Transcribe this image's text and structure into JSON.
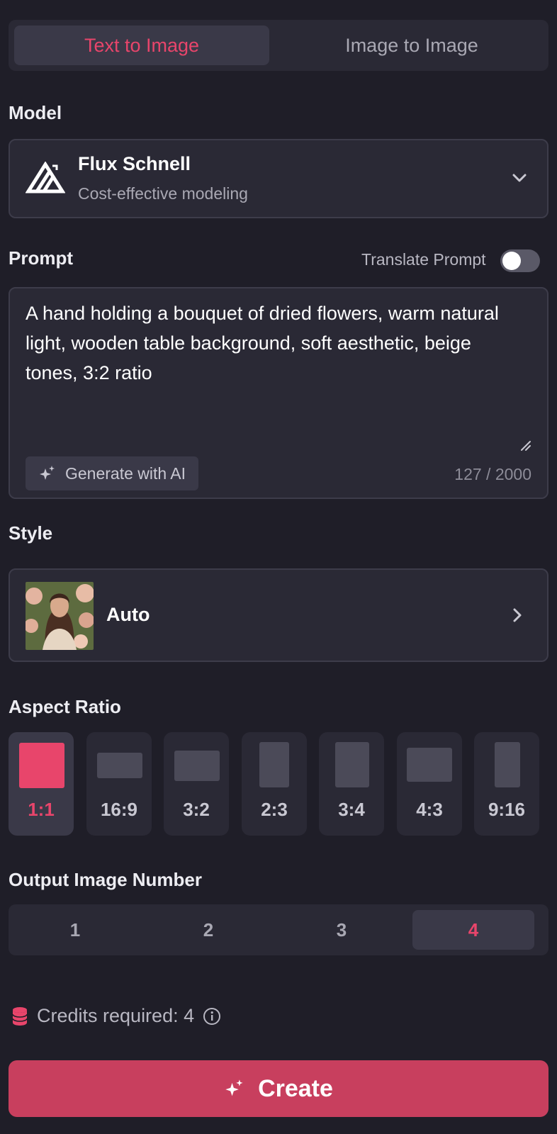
{
  "tabs": [
    {
      "label": "Text to Image",
      "active": true
    },
    {
      "label": "Image to Image",
      "active": false
    }
  ],
  "model": {
    "section_label": "Model",
    "name": "Flux Schnell",
    "description": "Cost-effective modeling",
    "icon": "chevron-down-icon"
  },
  "prompt": {
    "section_label": "Prompt",
    "translate_label": "Translate Prompt",
    "translate_enabled": false,
    "text": "A hand holding a bouquet of dried flowers, warm natural light, wooden table background, soft aesthetic, beige tones, 3:2 ratio",
    "generate_label": "Generate with AI",
    "char_count": "127 / 2000"
  },
  "style": {
    "section_label": "Style",
    "value": "Auto"
  },
  "aspect_ratio": {
    "section_label": "Aspect Ratio",
    "options": [
      {
        "label": "1:1",
        "active": true
      },
      {
        "label": "16:9",
        "active": false
      },
      {
        "label": "3:2",
        "active": false
      },
      {
        "label": "2:3",
        "active": false
      },
      {
        "label": "3:4",
        "active": false
      },
      {
        "label": "4:3",
        "active": false
      },
      {
        "label": "9:16",
        "active": false
      }
    ]
  },
  "output_number": {
    "section_label": "Output Image Number",
    "options": [
      "1",
      "2",
      "3",
      "4"
    ],
    "selected": "4"
  },
  "credits": {
    "label": "Credits required: 4"
  },
  "create": {
    "label": "Create"
  },
  "colors": {
    "accent": "#e8456b",
    "create_button": "#c83f5e",
    "background": "#1f1e28",
    "panel": "#2a2935"
  }
}
